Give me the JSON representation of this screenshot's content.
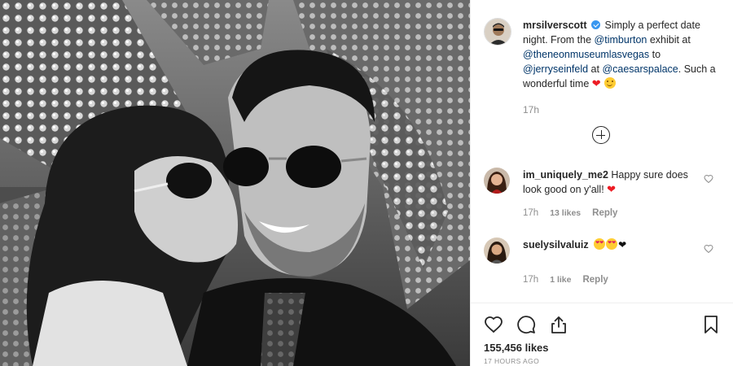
{
  "post": {
    "author": "mrsilverscott",
    "caption_parts": [
      "Simply a perfect date night. From the ",
      "@timburton",
      " exhibit at ",
      "@theneonmuseumlasvegas",
      " to ",
      "@jerryseinfeld",
      " at ",
      "@caesarspalace",
      ". Such a wonderful time "
    ],
    "caption_emoji": [
      "heart-emoji",
      "smile-emoji"
    ],
    "caption_timestamp": "17h",
    "photo_alt_icon": "photo"
  },
  "comments": [
    {
      "username": "im_uniquely_me2",
      "text": "Happy sure does look good on y'all!",
      "emoji": [
        "red-heart"
      ],
      "time": "17h",
      "likes": "13 likes",
      "reply": "Reply"
    },
    {
      "username": "suelysilvaluiz",
      "text": "",
      "emoji": [
        "heart-eyes",
        "heart-eyes",
        "black-heart"
      ],
      "time": "17h",
      "likes": "1 like",
      "reply": "Reply"
    }
  ],
  "actions": {
    "icons": [
      "heart-icon",
      "comment-icon",
      "share-icon",
      "bookmark-icon"
    ],
    "likes": "155,456 likes",
    "time_ago": "17 HOURS AGO"
  },
  "colors": {
    "verified": "#3897f0",
    "mention": "#003569",
    "heart": "#ed1c24",
    "meta": "#8e8e8e"
  }
}
